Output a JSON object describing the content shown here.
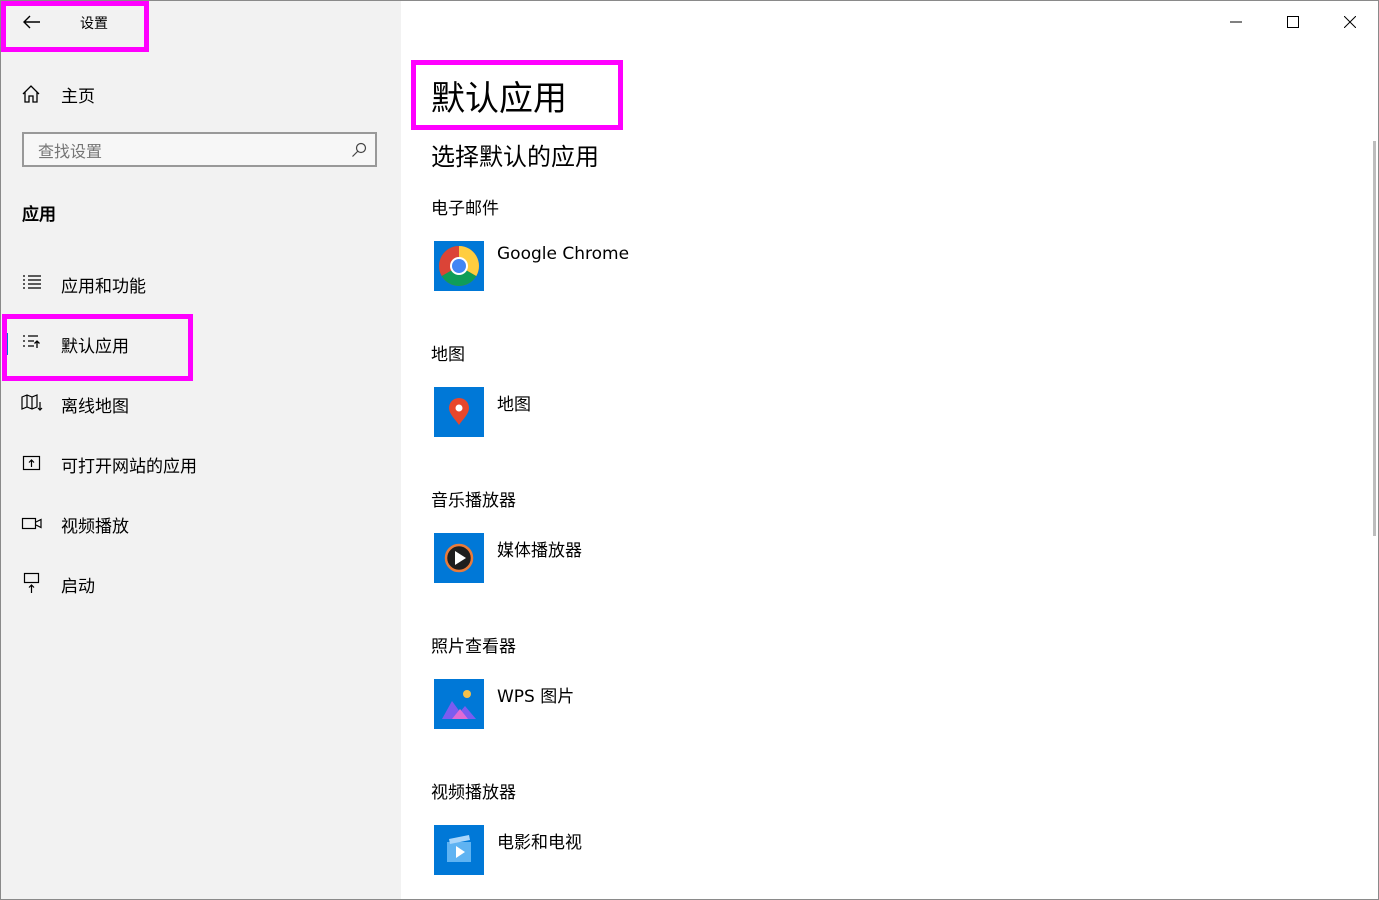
{
  "window": {
    "title": "设置",
    "controls": [
      "minimize-icon",
      "maximize-icon",
      "close-icon"
    ]
  },
  "sidebar": {
    "home_label": "主页",
    "search_placeholder": "查找设置",
    "section_header": "应用",
    "items": [
      {
        "label": "应用和功能",
        "icon": "apps-features-icon",
        "selected": false
      },
      {
        "label": "默认应用",
        "icon": "default-apps-icon",
        "selected": true
      },
      {
        "label": "离线地图",
        "icon": "offline-maps-icon",
        "selected": false
      },
      {
        "label": "可打开网站的应用",
        "icon": "apps-for-websites-icon",
        "selected": false
      },
      {
        "label": "视频播放",
        "icon": "video-playback-icon",
        "selected": false
      },
      {
        "label": "启动",
        "icon": "startup-icon",
        "selected": false
      }
    ]
  },
  "main": {
    "title": "默认应用",
    "subtitle": "选择默认的应用",
    "categories": [
      {
        "label": "电子邮件",
        "app": "Google Chrome",
        "icon": "chrome-icon"
      },
      {
        "label": "地图",
        "app": "地图",
        "icon": "maps-pin-icon"
      },
      {
        "label": "音乐播放器",
        "app": "媒体播放器",
        "icon": "media-player-icon"
      },
      {
        "label": "照片查看器",
        "app": "WPS 图片",
        "icon": "wps-pictures-icon"
      },
      {
        "label": "视频播放器",
        "app": "电影和电视",
        "icon": "movies-tv-icon"
      }
    ]
  },
  "colors": {
    "accent": "#0078d7",
    "highlight": "#ff00ff",
    "sidebar_bg": "#f2f2f2"
  }
}
